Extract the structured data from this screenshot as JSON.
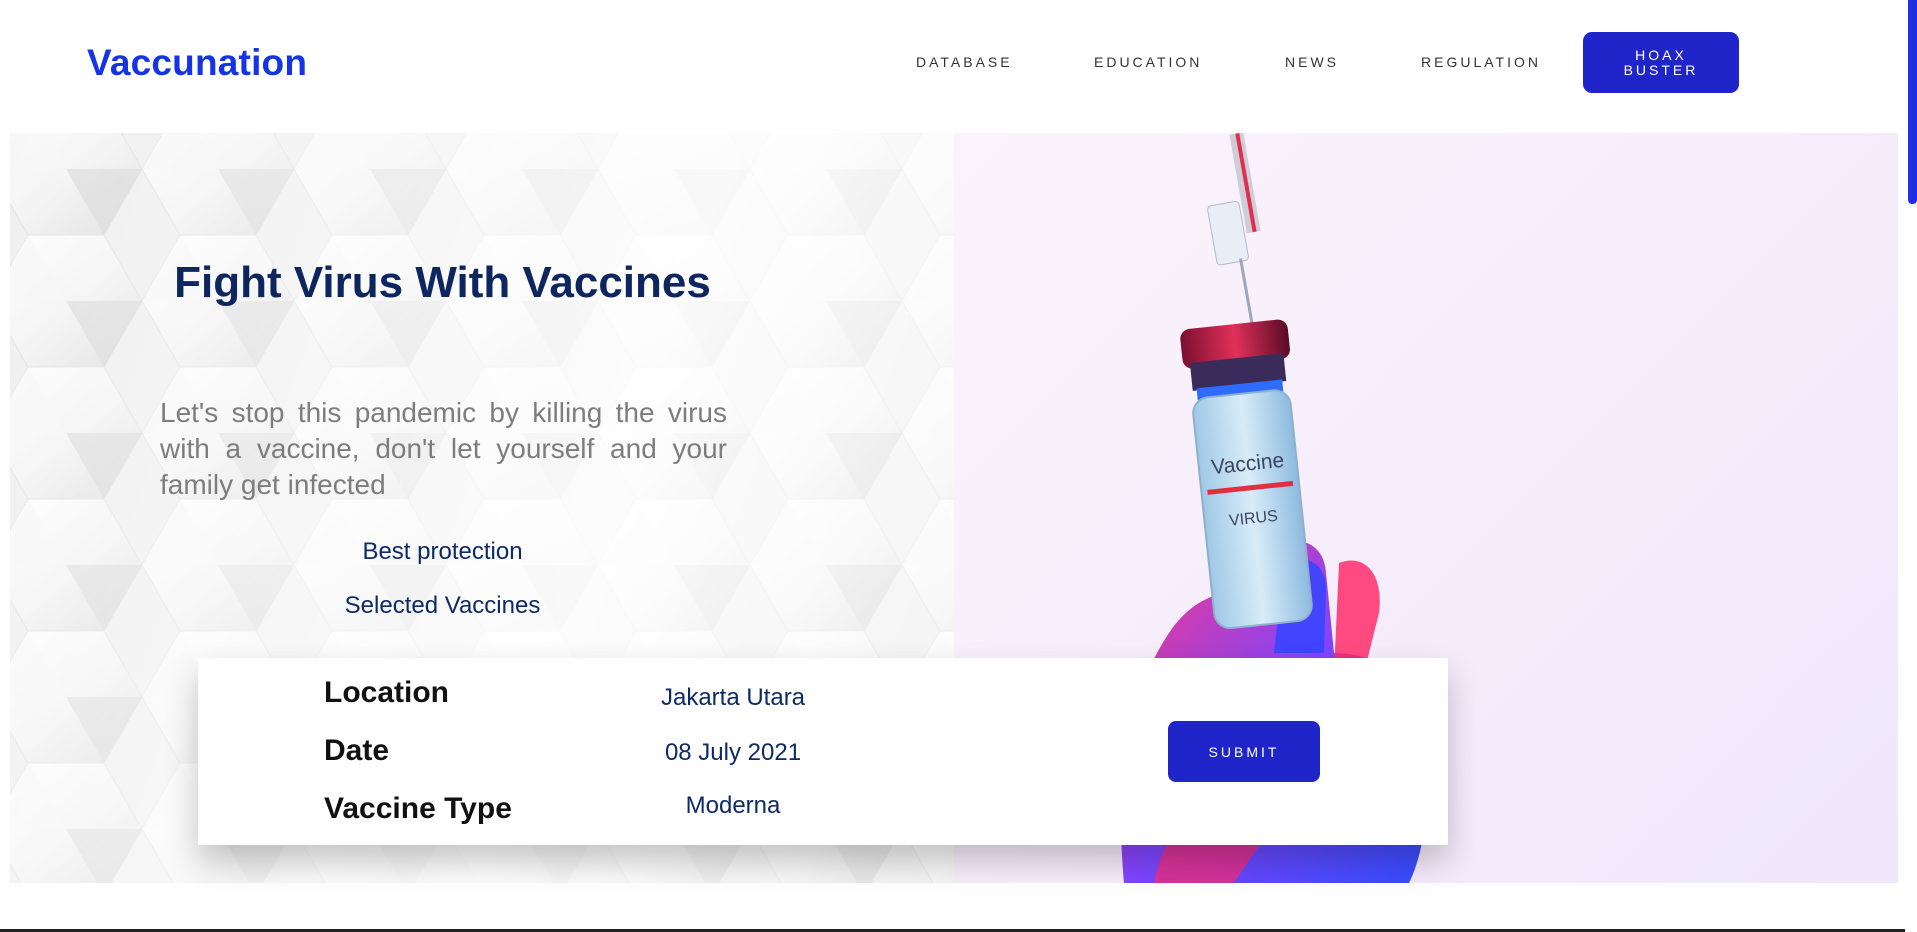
{
  "header": {
    "brand": "Vaccunation",
    "nav": [
      {
        "label": "DATABASE"
      },
      {
        "label": "EDUCATION"
      },
      {
        "label": "NEWS"
      },
      {
        "label": "REGULATION"
      }
    ],
    "cta_line1": "HOAX",
    "cta_line2": "BUSTER"
  },
  "hero": {
    "title": "Fight Virus With Vaccines",
    "description": "Let's stop this pandemic by killing the virus with a vaccine, don't let yourself and your family get infected",
    "features": [
      "Best protection",
      "Selected Vaccines"
    ],
    "image": {
      "vial_label": "Vaccine",
      "vial_sublabel": "VIRUS"
    }
  },
  "booking": {
    "location_label": "Location",
    "location_value": "Jakarta Utara",
    "date_label": "Date",
    "date_value": "08 July 2021",
    "type_label": "Vaccine Type",
    "type_value": "Moderna",
    "submit_label": "SUBMIT"
  },
  "colors": {
    "brand": "#1434e6",
    "button": "#1f25c8",
    "heading": "#0d2660",
    "body_text": "#7d7d7d"
  }
}
